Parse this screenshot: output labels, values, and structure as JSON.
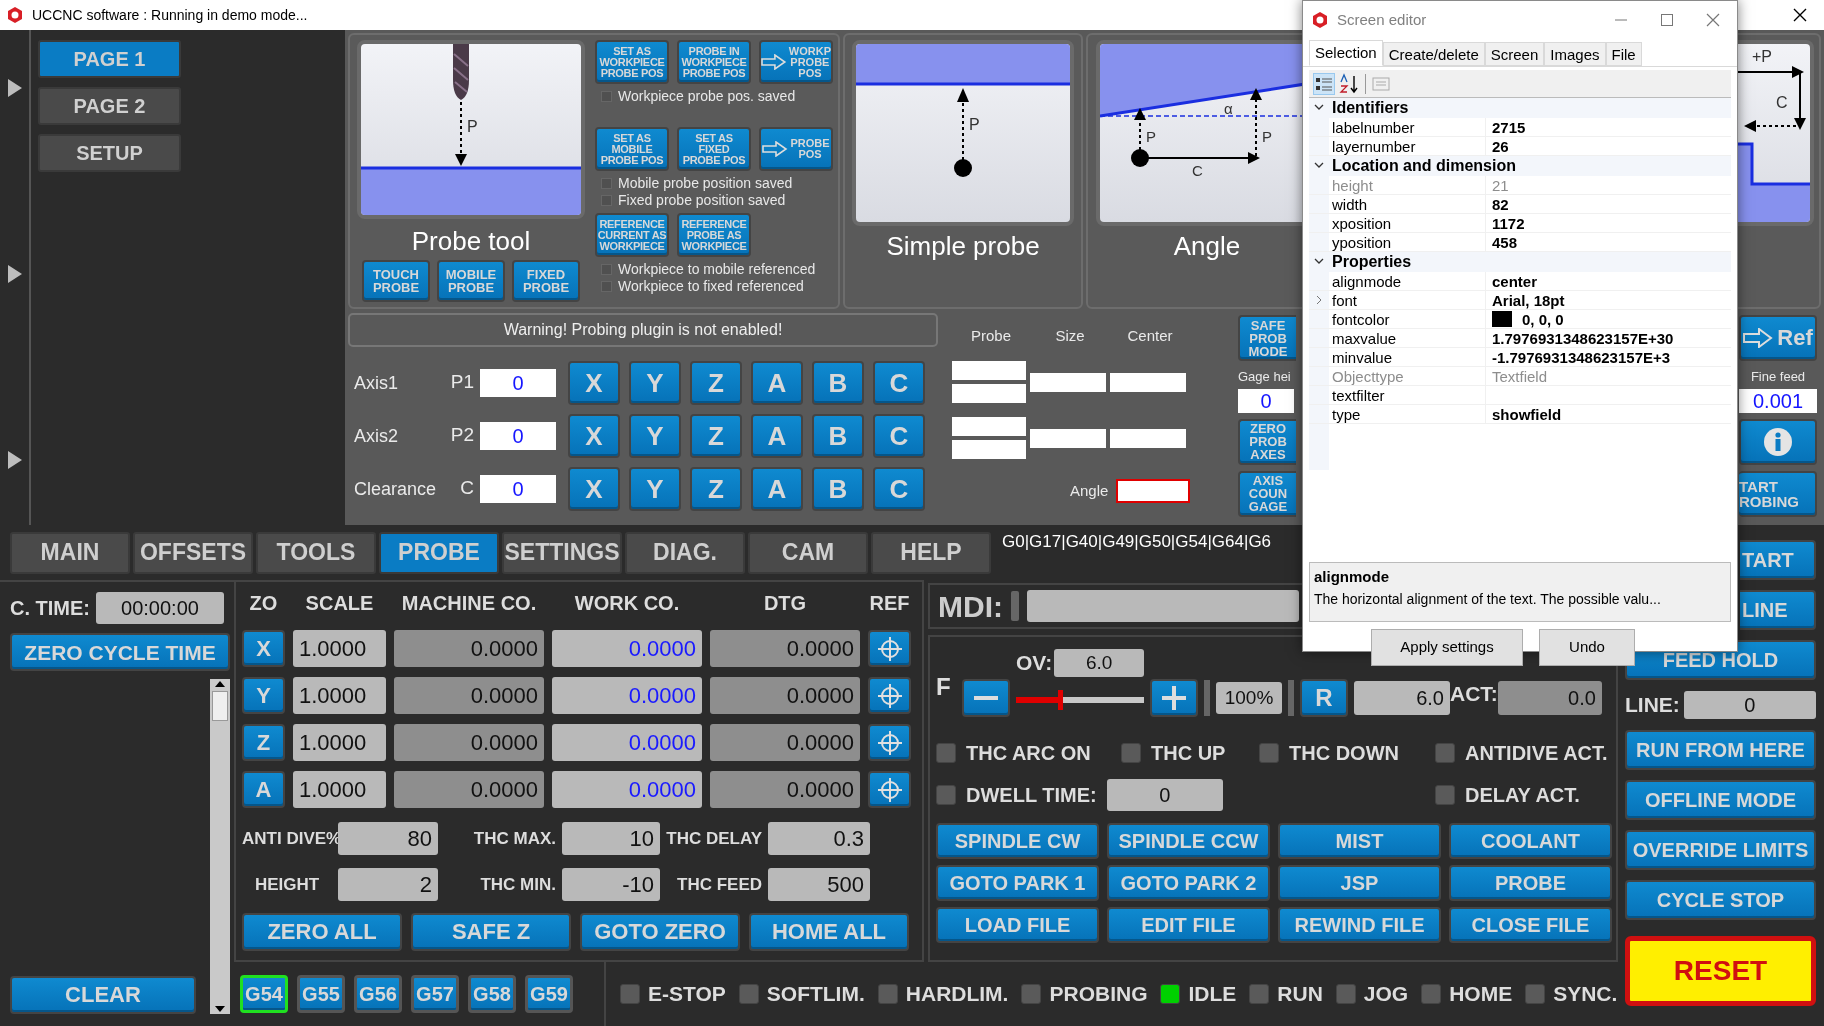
{
  "title_bar": {
    "title": "UCCNC software : Running in demo mode..."
  },
  "pages": [
    {
      "label": "PAGE 1",
      "selected": true
    },
    {
      "label": "PAGE 2",
      "selected": false
    },
    {
      "label": "SETUP",
      "selected": false
    }
  ],
  "probe_tool": {
    "caption": "Probe tool",
    "diagram_labels": [
      "P"
    ],
    "mode_buttons": [
      "TOUCH\nPROBE",
      "MOBILE\nPROBE",
      "FIXED\nPROBE"
    ],
    "groups": [
      {
        "buttons": [
          {
            "label": "SET AS\nWORKPIECE\nPROBE POS",
            "kind": "text"
          },
          {
            "label": "PROBE IN\nWORKPIECE\nPROBE POS",
            "kind": "text"
          },
          {
            "label": "WORKP\nPROBE\nPOS",
            "kind": "arrow"
          }
        ],
        "checks": [
          {
            "label": "Workpiece probe pos. saved",
            "checked": false
          }
        ]
      },
      {
        "buttons": [
          {
            "label": "SET AS\nMOBILE\nPROBE POS",
            "kind": "text"
          },
          {
            "label": "SET AS\nFIXED\nPROBE POS",
            "kind": "text"
          },
          {
            "label": "PROBE\nPOS",
            "kind": "arrow"
          }
        ],
        "checks": [
          {
            "label": "Mobile probe position saved",
            "checked": false
          },
          {
            "label": "Fixed probe position saved",
            "checked": false
          }
        ]
      },
      {
        "buttons": [
          {
            "label": "REFERENCE\nCURRENT AS\nWORKPIECE",
            "kind": "text"
          },
          {
            "label": "REFERENCE\nPROBE AS\nWORKPIECE",
            "kind": "text"
          }
        ],
        "checks": [
          {
            "label": "Workpiece to mobile referenced",
            "checked": false
          },
          {
            "label": "Workpiece to fixed referenced",
            "checked": false
          }
        ]
      }
    ]
  },
  "probe_cards": [
    {
      "caption": "Simple probe",
      "kind": "simple",
      "labels": [
        "P"
      ]
    },
    {
      "caption": "Angle",
      "kind": "angle",
      "labels": [
        "α",
        "P",
        "P",
        "C"
      ]
    },
    {
      "kind": "corner",
      "labels": [
        "+P",
        "C"
      ]
    }
  ],
  "warning": "Warning! Probing plugin is not enabled!",
  "axis_rows": [
    {
      "name": "Axis1",
      "param": "P1",
      "value": "0",
      "axes": [
        "X",
        "Y",
        "Z",
        "A",
        "B",
        "C"
      ]
    },
    {
      "name": "Axis2",
      "param": "P2",
      "value": "0",
      "axes": [
        "X",
        "Y",
        "Z",
        "A",
        "B",
        "C"
      ]
    },
    {
      "name": "Clearance",
      "param": "C",
      "value": "0",
      "axes": [
        "X",
        "Y",
        "Z",
        "A",
        "B",
        "C"
      ]
    }
  ],
  "result_headers": [
    "Probe",
    "Size",
    "Center"
  ],
  "angle_label": "Angle",
  "probe_side": {
    "buttons": [
      "SAFE\nPROB\nMODE",
      "ZERO\nPROB\nAXES",
      "AXIS\nCOUN\nGAGE"
    ],
    "gage_label": "Gage hei",
    "gage_value": "0"
  },
  "probe_right": {
    "ref_button": "Ref",
    "fine_label": "Fine feed",
    "fine_value": "0.001",
    "start_button": "TART\nROBING"
  },
  "tabs": [
    {
      "label": "MAIN",
      "selected": false
    },
    {
      "label": "OFFSETS",
      "selected": false
    },
    {
      "label": "TOOLS",
      "selected": false
    },
    {
      "label": "PROBE",
      "selected": true
    },
    {
      "label": "SETTINGS",
      "selected": false
    },
    {
      "label": "DIAG.",
      "selected": false
    },
    {
      "label": "CAM",
      "selected": false
    },
    {
      "label": "HELP",
      "selected": false
    }
  ],
  "gcode": "G0|G17|G40|G49|G50|G54|G64|G6",
  "cycle": {
    "label": "C. TIME:",
    "value": "00:00:00",
    "zero_button": "ZERO CYCLE TIME",
    "clear_button": "CLEAR"
  },
  "dro": {
    "headers": [
      "ZO",
      "SCALE",
      "MACHINE CO.",
      "WORK CO.",
      "DTG",
      "REF"
    ],
    "rows": [
      {
        "axis": "X",
        "scale": "1.0000",
        "machine": "0.0000",
        "work": "0.0000",
        "dtg": "0.0000"
      },
      {
        "axis": "Y",
        "scale": "1.0000",
        "machine": "0.0000",
        "work": "0.0000",
        "dtg": "0.0000"
      },
      {
        "axis": "Z",
        "scale": "1.0000",
        "machine": "0.0000",
        "work": "0.0000",
        "dtg": "0.0000"
      },
      {
        "axis": "A",
        "scale": "1.0000",
        "machine": "0.0000",
        "work": "0.0000",
        "dtg": "0.0000"
      }
    ]
  },
  "thc_fields": [
    {
      "label": "ANTI DIVE%",
      "value": "80"
    },
    {
      "label": "THC MAX.",
      "value": "10"
    },
    {
      "label": "THC DELAY",
      "value": "0.3"
    },
    {
      "label": "HEIGHT",
      "value": "2"
    },
    {
      "label": "THC MIN.",
      "value": "-10"
    },
    {
      "label": "THC FEED",
      "value": "500"
    }
  ],
  "dro_buttons": [
    "ZERO ALL",
    "SAFE Z",
    "GOTO ZERO",
    "HOME ALL"
  ],
  "offsets": [
    {
      "label": "G54",
      "selected": true
    },
    {
      "label": "G55",
      "selected": false
    },
    {
      "label": "G56",
      "selected": false
    },
    {
      "label": "G57",
      "selected": false
    },
    {
      "label": "G58",
      "selected": false
    },
    {
      "label": "G59",
      "selected": false
    }
  ],
  "status": [
    {
      "label": "E-STOP",
      "on": false
    },
    {
      "label": "SOFTLIM.",
      "on": false
    },
    {
      "label": "HARDLIM.",
      "on": false
    },
    {
      "label": "PROBING",
      "on": false
    },
    {
      "label": "IDLE",
      "on": true
    },
    {
      "label": "RUN",
      "on": false
    },
    {
      "label": "JOG",
      "on": false
    },
    {
      "label": "HOME",
      "on": false
    },
    {
      "label": "SYNC.",
      "on": false
    }
  ],
  "mdi": {
    "label": "MDI:"
  },
  "feed": {
    "f_label": "F",
    "ov_label": "OV:",
    "ov_value": "6.0",
    "level": 0.34,
    "percent": "100%",
    "reset_button": "R",
    "set_value": "6.0",
    "act_label": "ACT:",
    "act_value": "0.0"
  },
  "thc_checks": [
    {
      "label": "THC ARC ON",
      "checked": false
    },
    {
      "label": "THC UP",
      "checked": false
    },
    {
      "label": "THC DOWN",
      "checked": false
    },
    {
      "label": "ANTIDIVE ACT.",
      "checked": false
    }
  ],
  "dwell": {
    "label": "DWELL TIME:",
    "value": "0",
    "checked": false
  },
  "delay": {
    "label": "DELAY ACT.",
    "checked": false
  },
  "function_buttons": [
    "SPINDLE CW",
    "SPINDLE CCW",
    "MIST",
    "COOLANT",
    "GOTO PARK 1",
    "GOTO PARK 2",
    "JSP",
    "PROBE",
    "LOAD FILE",
    "EDIT FILE",
    "REWIND FILE",
    "CLOSE FILE"
  ],
  "right_column": [
    {
      "kind": "button",
      "label": "TART"
    },
    {
      "kind": "button",
      "label": "LINE"
    },
    {
      "kind": "button",
      "label": "FEED HOLD"
    },
    {
      "kind": "line",
      "label": "LINE:",
      "value": "0"
    },
    {
      "kind": "button",
      "label": "RUN FROM HERE"
    },
    {
      "kind": "button",
      "label": "OFFLINE MODE"
    },
    {
      "kind": "button",
      "label": "OVERRIDE LIMITS"
    },
    {
      "kind": "button",
      "label": "CYCLE STOP"
    },
    {
      "kind": "reset",
      "label": "RESET"
    }
  ],
  "editor": {
    "title": "Screen editor",
    "tabs": [
      {
        "label": "Selection",
        "selected": true
      },
      {
        "label": "Create/delete",
        "selected": false
      },
      {
        "label": "Screen",
        "selected": false
      },
      {
        "label": "Images",
        "selected": false
      },
      {
        "label": "File",
        "selected": false
      }
    ],
    "groups": [
      {
        "name": "Identifiers",
        "expanded": true,
        "props": [
          {
            "name": "labelnumber",
            "value": "2715",
            "readonly": false
          },
          {
            "name": "layernumber",
            "value": "26",
            "readonly": false
          }
        ]
      },
      {
        "name": "Location and dimension",
        "expanded": true,
        "props": [
          {
            "name": "height",
            "value": "21",
            "readonly": true
          },
          {
            "name": "width",
            "value": "82",
            "readonly": false
          },
          {
            "name": "xposition",
            "value": "1172",
            "readonly": false
          },
          {
            "name": "yposition",
            "value": "458",
            "readonly": false
          }
        ]
      },
      {
        "name": "Properties",
        "expanded": true,
        "props": [
          {
            "name": "alignmode",
            "value": "center",
            "readonly": false
          },
          {
            "name": "font",
            "value": "Arial, 18pt",
            "readonly": false,
            "expandable": true
          },
          {
            "name": "fontcolor",
            "value": "0, 0, 0",
            "readonly": false,
            "color": "#000000"
          },
          {
            "name": "maxvalue",
            "value": "1.7976931348623157E+30",
            "readonly": false
          },
          {
            "name": "minvalue",
            "value": "-1.7976931348623157E+3",
            "readonly": false
          },
          {
            "name": "Objecttype",
            "value": "Textfield",
            "readonly": true
          },
          {
            "name": "textfilter",
            "readonly": false
          },
          {
            "name": "type",
            "value": "showfield",
            "readonly": false
          }
        ]
      }
    ],
    "description": {
      "title": "alignmode",
      "text": "The horizontal alignment of the text. The possible valu..."
    },
    "buttons": [
      "Apply settings",
      "Undo"
    ]
  }
}
